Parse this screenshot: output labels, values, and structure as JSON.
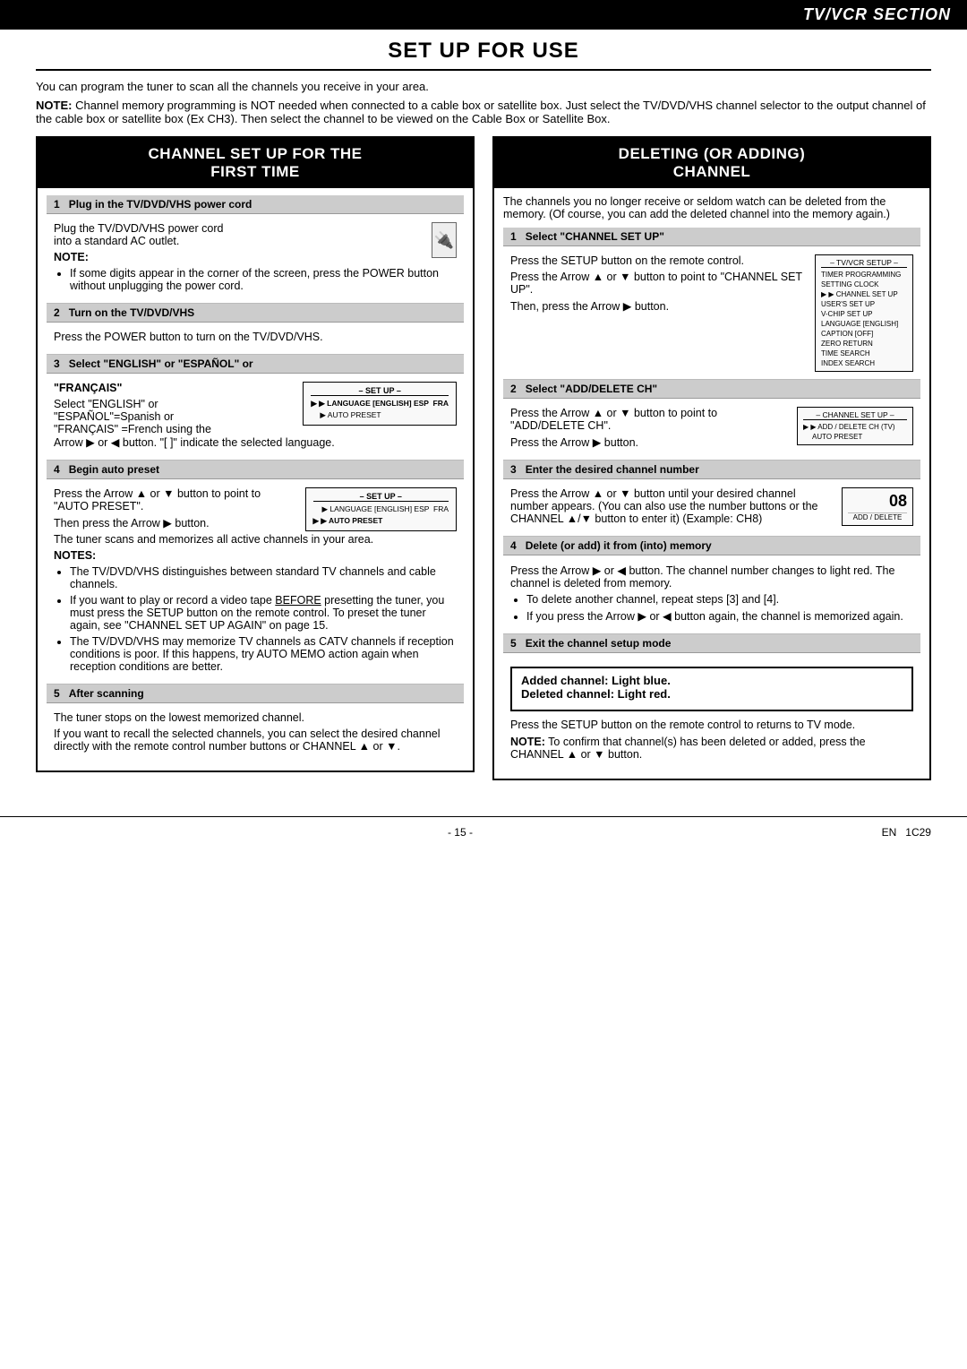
{
  "tvvcr_section": "TV/VCR SECTION",
  "main_title": "SET UP FOR USE",
  "intro": {
    "line1": "You can program the tuner to scan all the channels you receive in your area.",
    "note": "NOTE: Channel memory programming is NOT needed when connected to a cable box or satellite box. Just select the TV/DVD/VHS channel selector to the output channel of the cable box or satellite box (Ex CH3). Then select the channel to be viewed on the Cable Box or Satellite Box."
  },
  "left_section": {
    "title": "CHANNEL SET UP FOR THE\nFIRST TIME",
    "steps": [
      {
        "num": "1",
        "header": "Plug in the TV/DVD/VHS power cord",
        "body": [
          "Plug the TV/DVD/VHS power cord",
          "into a standard AC outlet."
        ],
        "note_label": "NOTE:",
        "note_bullets": [
          "If some digits appear in the corner of the screen, press the POWER button without unplugging the power cord."
        ],
        "has_plug_icon": true
      },
      {
        "num": "2",
        "header": "Turn on the TV/DVD/VHS",
        "body": [
          "Press the POWER button to turn on the TV/DVD/VHS."
        ]
      },
      {
        "num": "3",
        "header": "Select \"ENGLISH\" or \"ESPAÑOL\" or",
        "subheader": "\"FRANÇAIS\"",
        "body": [
          "Select \"ENGLISH\" or",
          "\"ESPAÑOL\"=Spanish or",
          "\"FRANÇAIS\" =French using the",
          "Arrow ▶ or ◀ button. \"[ ]\" indicate the selected language."
        ],
        "screen": {
          "title": "– SET UP –",
          "items": [
            {
              "label": "LANGUAGE [ENGLISH] ESP  FRA",
              "selected": true
            },
            {
              "label": "AUTO PRESET",
              "selected": false
            }
          ]
        }
      },
      {
        "num": "4",
        "header": "Begin auto preset",
        "body": [
          "Press the Arrow ▲ or ▼ button to point to \"AUTO PRESET\".",
          "Then press the Arrow ▶ button.",
          "The tuner scans and memorizes all active channels in your area."
        ],
        "notes_label": "NOTES:",
        "notes_bullets": [
          "The TV/DVD/VHS distinguishes between standard TV channels and cable channels.",
          "If you want to play or record a video tape BEFORE presetting the tuner, you must press the SETUP button on the remote control. To preset the tuner again, see \"CHANNEL SET UP AGAIN\" on page 15.",
          "The TV/DVD/VHS may memorize TV channels as CATV channels if reception conditions is poor. If this happens, try AUTO MEMO action again when reception conditions are better."
        ],
        "screen": {
          "title": "– SET UP –",
          "items": [
            {
              "label": "LANGUAGE [ENGLISH] ESP  FRA",
              "selected": false
            },
            {
              "label": "AUTO PRESET",
              "selected": true
            }
          ]
        }
      },
      {
        "num": "5",
        "header": "After scanning",
        "body": [
          "The tuner stops on the lowest memorized channel.",
          "If you want to recall the selected channels, you can select the desired channel directly with the remote control number buttons or CHANNEL ▲ or ▼."
        ]
      }
    ]
  },
  "right_section": {
    "title": "DELETING (OR ADDING)\nCHANNEL",
    "intro": "The channels you no longer receive or seldom watch can be deleted from the memory. (Of course, you can add the deleted channel into the memory again.)",
    "steps": [
      {
        "num": "1",
        "header": "Select \"CHANNEL SET UP\"",
        "body": [
          "Press the SETUP button on the remote control.",
          "Press the Arrow ▲ or ▼ button to point to \"CHANNEL SET UP\".",
          "Then, press the Arrow ▶ button."
        ],
        "menu": {
          "title": "– TV/VCR SETUP –",
          "items": [
            "TIMER PROGRAMMING",
            "SETTING CLOCK",
            "CHANNEL SET UP",
            "USER'S SET UP",
            "V-CHIP SET UP",
            "LANGUAGE [ENGLISH]",
            "CAPTION [OFF]",
            "ZERO RETURN",
            "TIME SEARCH",
            "INDEX SEARCH"
          ],
          "selected": "CHANNEL SET UP"
        }
      },
      {
        "num": "2",
        "header": "Select \"ADD/DELETE CH\"",
        "body": [
          "Press the Arrow ▲ or ▼ button to point to \"ADD/DELETE CH\".",
          "Press the Arrow ▶ button."
        ],
        "menu": {
          "title": "– CHANNEL SET UP –",
          "items": [
            "ADD / DELETE CH (TV)",
            "AUTO PRESET"
          ],
          "selected": "ADD / DELETE CH (TV)"
        }
      },
      {
        "num": "3",
        "header": "Enter the desired channel number",
        "body": [
          "Press the Arrow ▲ or ▼ button until your desired channel number appears. (You can also use the number buttons or the CHANNEL ▲/▼ button to enter it) (Example: CH8)"
        ],
        "display": {
          "value": "08",
          "label": "ADD / DELETE"
        }
      },
      {
        "num": "4",
        "header": "Delete (or add) it from (into) memory",
        "body": [
          "Press the Arrow ▶ or ◀ button. The channel number changes to light red. The channel is deleted from memory."
        ],
        "bullets": [
          "To delete another channel, repeat steps [3] and [4].",
          "If you press the Arrow ▶ or ◀ button again, the channel is memorized again."
        ]
      },
      {
        "num": "5",
        "header": "Exit the channel setup mode",
        "highlight": {
          "line1": "Added channel: Light blue.",
          "line2": "Deleted channel: Light red."
        },
        "body": [
          "Press the SETUP button on the remote control to returns to TV mode.",
          "NOTE: To confirm that channel(s) has been deleted or added, press the CHANNEL ▲ or ▼ button."
        ]
      }
    ]
  },
  "footer": {
    "page_num": "- 15 -",
    "lang": "EN",
    "code": "1C29"
  }
}
